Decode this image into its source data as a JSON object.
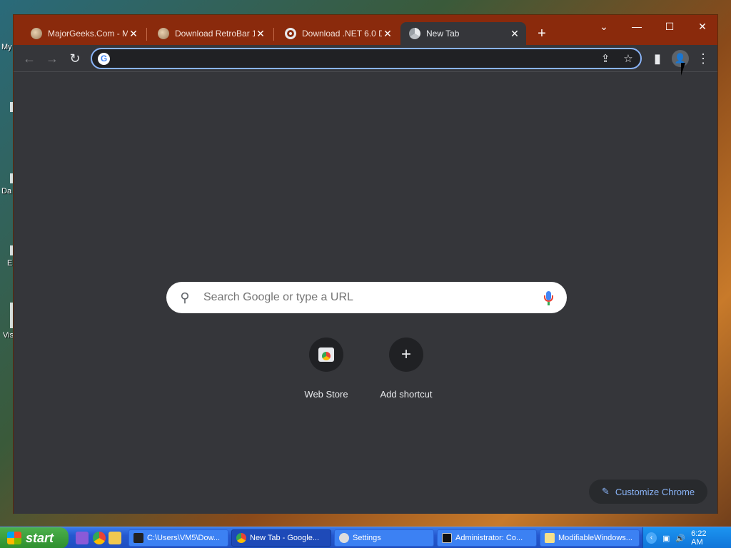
{
  "desktop": {
    "labels": [
      "My",
      "Da",
      "E",
      "Vis"
    ]
  },
  "tabs": [
    {
      "title": "MajorGeeks.Com - M",
      "close": "✕",
      "icon": "majorgeeks-favicon"
    },
    {
      "title": "Download RetroBar 1",
      "close": "✕",
      "icon": "majorgeeks-favicon"
    },
    {
      "title": "Download .NET 6.0 D",
      "close": "✕",
      "icon": "globe-icon"
    },
    {
      "title": "New Tab",
      "close": "✕",
      "icon": "chrome-icon"
    }
  ],
  "titlebar": {
    "new_tab": "+",
    "dropdown": "⌄",
    "minimize": "—",
    "maximize": "☐",
    "close": "✕"
  },
  "toolbar": {
    "back": "←",
    "forward": "→",
    "reload": "↻",
    "omnibox_value": "",
    "share": "⇪",
    "bookmark": "☆",
    "side_panel": "▮",
    "menu": "⋮",
    "profile": "👤"
  },
  "ntp": {
    "search_placeholder": "Search Google or type a URL",
    "shortcuts": [
      {
        "label": "Web Store",
        "icon": "webstore-icon"
      },
      {
        "label": "Add shortcut",
        "icon": "plus-icon"
      }
    ],
    "customize_label": "Customize Chrome"
  },
  "taskbar": {
    "start_label": "start",
    "tasks": [
      {
        "label": "C:\\Users\\VM5\\Dow...",
        "icon": "7zip-icon"
      },
      {
        "label": "New Tab - Google...",
        "icon": "chrome-icon"
      },
      {
        "label": "Settings",
        "icon": "gear-icon"
      },
      {
        "label": "Administrator:  Co...",
        "icon": "cmd-icon"
      },
      {
        "label": "ModifiableWindows...",
        "icon": "folder-icon"
      }
    ],
    "clock": "6:22 AM",
    "tray_arrow": "‹"
  },
  "colors": {
    "titlebar": "#8a2a0c",
    "content_bg": "#35363a",
    "accent": "#8ab4f8",
    "taskbar": "#2458d0",
    "start_button": "#3a9a3a"
  }
}
